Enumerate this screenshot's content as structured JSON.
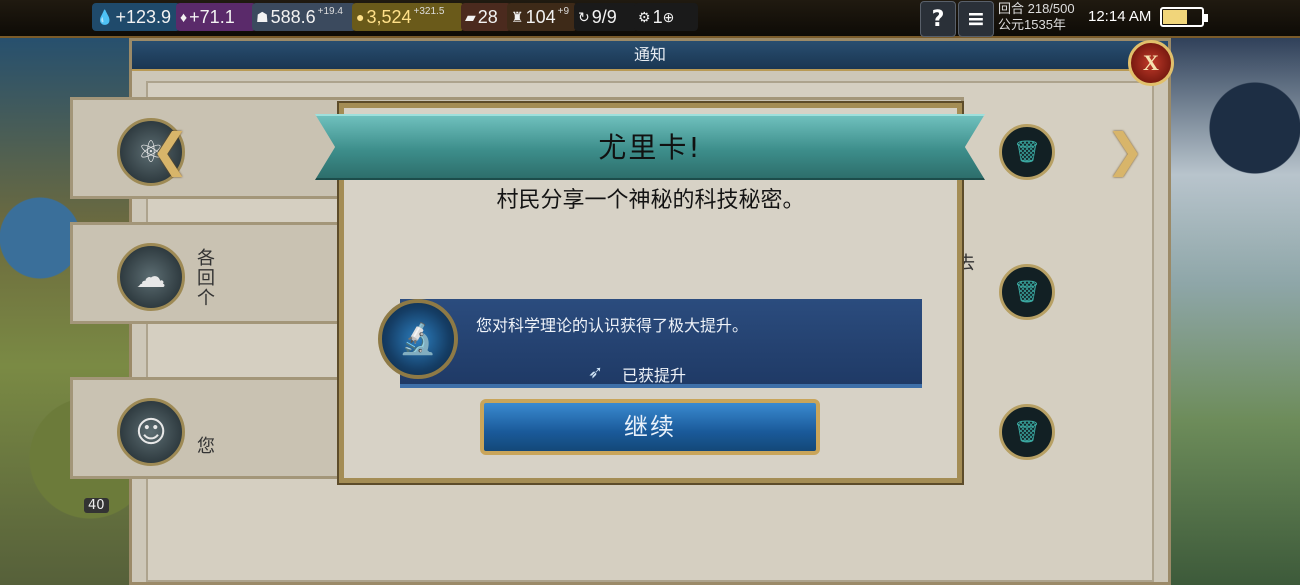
{
  "topbar": {
    "science": "+123.9",
    "culture": "+71.1",
    "faith": "588.6",
    "faith_rate": "+19.4",
    "gold": "3,524",
    "gold_rate": "+321.5",
    "stat_a": "28",
    "stat_b": "104",
    "stat_b_rate": "+9",
    "stat_c": "9/9",
    "stat_d": "1",
    "help_label": "?",
    "menu_label": "≡",
    "turn": "回合 218/500",
    "year": "公元1535年",
    "time": "12:14 AM"
  },
  "panel": {
    "title": "通知",
    "close_label": "X"
  },
  "popup": {
    "title": "尤里卡!",
    "subtitle": "村民分享一个神秘的科技秘密。",
    "reward_text": "您对科学理论的认识获得了极大提升。",
    "reward_status": "已获提升",
    "continue_label": "继续"
  },
  "rows": [
    {
      "icon": "atom-icon",
      "partial": ""
    },
    {
      "icon": "storm-icon",
      "partial_left": "各\n回\n个",
      "partial_right": "去"
    },
    {
      "icon": "face-icon",
      "partial_left": "您"
    }
  ],
  "left_map": {
    "badge": "40"
  }
}
